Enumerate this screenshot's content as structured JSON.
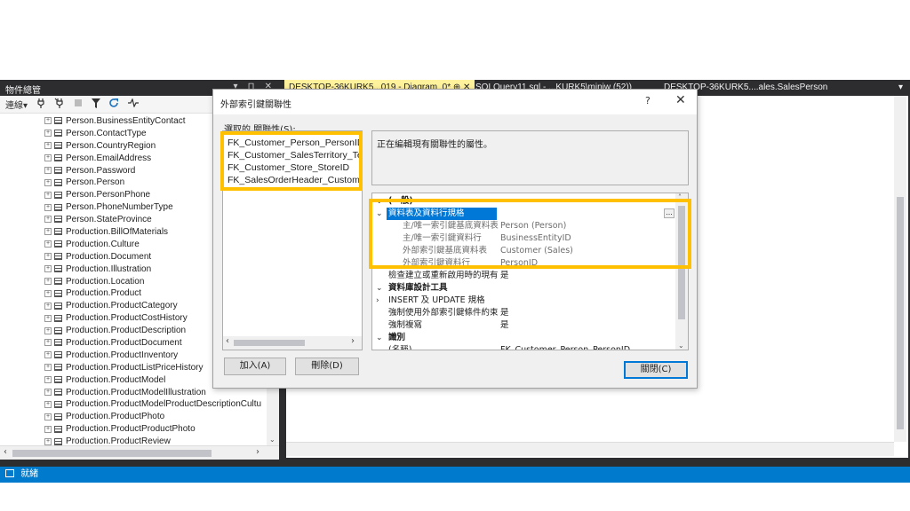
{
  "object_explorer": {
    "title": "物件總管",
    "pin_controls": "▾ ⊓ ✕",
    "toolbar": {
      "connect_label": "連線▾",
      "icons": [
        "connect-plug-icon",
        "disconnect-plug-icon",
        "stop-icon",
        "filter-icon",
        "refresh-icon",
        "activity-monitor-icon"
      ]
    },
    "tree_items": [
      "Person.BusinessEntityContact",
      "Person.ContactType",
      "Person.CountryRegion",
      "Person.EmailAddress",
      "Person.Password",
      "Person.Person",
      "Person.PersonPhone",
      "Person.PhoneNumberType",
      "Person.StateProvince",
      "Production.BillOfMaterials",
      "Production.Culture",
      "Production.Document",
      "Production.Illustration",
      "Production.Location",
      "Production.Product",
      "Production.ProductCategory",
      "Production.ProductCostHistory",
      "Production.ProductDescription",
      "Production.ProductDocument",
      "Production.ProductInventory",
      "Production.ProductListPriceHistory",
      "Production.ProductModel",
      "Production.ProductModelIllustration",
      "Production.ProductModelProductDescriptionCultu",
      "Production.ProductPhoto",
      "Production.ProductProductPhoto",
      "Production.ProductReview"
    ]
  },
  "tabs": [
    {
      "label": "DESKTOP-36KURK5...019 - Diagram_0*  ⊕ ✕",
      "active": true
    },
    {
      "label": "SQLQuery11.sql - ...KURK5\\miniw (52))",
      "active": false
    },
    {
      "label": "DESKTOP-36KURK5....ales.SalesPerson",
      "active": false
    }
  ],
  "tab_overflow": "▾",
  "status": {
    "text": "就緒"
  },
  "dialog": {
    "title": "外部索引鍵關聯性",
    "help": "?",
    "close": "✕",
    "list_label": "選取的 關聯性(S):",
    "relationships": [
      "FK_Customer_Person_PersonID",
      "FK_Customer_SalesTerritory_Territo",
      "FK_Customer_Store_StoreID",
      "FK_SalesOrderHeader_Customer_C"
    ],
    "description": "正在編輯現有關聯性的屬性。",
    "add_button": "加入(A)",
    "delete_button": "刪除(D)",
    "close_button": "關閉(C)",
    "properties": [
      {
        "kind": "cat",
        "chev": "⌄",
        "name": "(一般)",
        "value": ""
      },
      {
        "kind": "selected",
        "chev": "⌄",
        "name": "資料表及資料行規格",
        "value": "",
        "ellipsis": "..."
      },
      {
        "kind": "sub",
        "chev": "",
        "name": "主/唯一索引鍵基底資料表",
        "value": "Person (Person)"
      },
      {
        "kind": "sub",
        "chev": "",
        "name": "主/唯一索引鍵資料行",
        "value": "BusinessEntityID"
      },
      {
        "kind": "sub",
        "chev": "",
        "name": "外部索引鍵基底資料表",
        "value": "Customer (Sales)"
      },
      {
        "kind": "sub",
        "chev": "",
        "name": "外部索引鍵資料行",
        "value": "PersonID"
      },
      {
        "kind": "prop",
        "chev": "",
        "name": "檢查建立或重新啟用時的現有",
        "value": "是"
      },
      {
        "kind": "cat",
        "chev": "⌄",
        "name": "資料庫設計工具",
        "value": ""
      },
      {
        "kind": "prop",
        "chev": "›",
        "name": "INSERT 及 UPDATE 規格",
        "value": ""
      },
      {
        "kind": "prop",
        "chev": "",
        "name": "強制使用外部索引鍵條件約束",
        "value": "是"
      },
      {
        "kind": "prop",
        "chev": "",
        "name": "強制複寫",
        "value": "是"
      },
      {
        "kind": "cat",
        "chev": "⌄",
        "name": "識別",
        "value": ""
      },
      {
        "kind": "prop",
        "chev": "",
        "name": "(名稱)",
        "value": "FK_Customer_Person_PersonID"
      }
    ]
  },
  "highlight_color": "#ffc000",
  "accent_color": "#0078d7",
  "statusbar_color": "#007acc"
}
